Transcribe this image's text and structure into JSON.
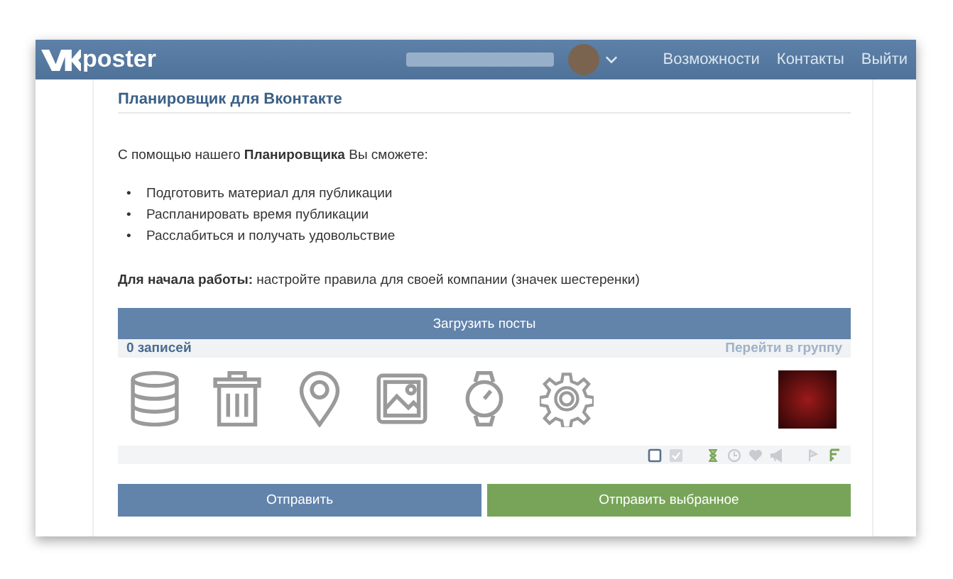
{
  "header": {
    "logo": "poster",
    "nav": [
      {
        "label": "Возможности"
      },
      {
        "label": "Контакты"
      },
      {
        "label": "Выйти"
      }
    ]
  },
  "content": {
    "title": "Планировщик для Вконтакте",
    "intro": "С помощью нашего **Планировщика** Вы сможете:",
    "bullets": [
      {
        "marker": "•",
        "text": "Подготовить материал для публикации"
      },
      {
        "marker": "•",
        "text": "Распланировать время публикации"
      },
      {
        "marker": "•",
        "text": "Расслабиться и получать удовольствие"
      }
    ],
    "hint": "**Для начала работы:** настройте правила для своей компании (значек шестеренки)"
  },
  "posts": {
    "load_button": "Загрузить посты",
    "count": "0 записей",
    "group_link": "Перейти в группу",
    "tools": [
      {
        "kind": "database"
      },
      {
        "kind": "trash"
      },
      {
        "kind": "pin"
      },
      {
        "kind": "image"
      },
      {
        "kind": "watch"
      },
      {
        "kind": "gear"
      }
    ]
  },
  "buttons": [
    {
      "label": "Отправить",
      "kind": "primary"
    },
    {
      "label": "Отправить выбранное",
      "kind": "success"
    }
  ]
}
